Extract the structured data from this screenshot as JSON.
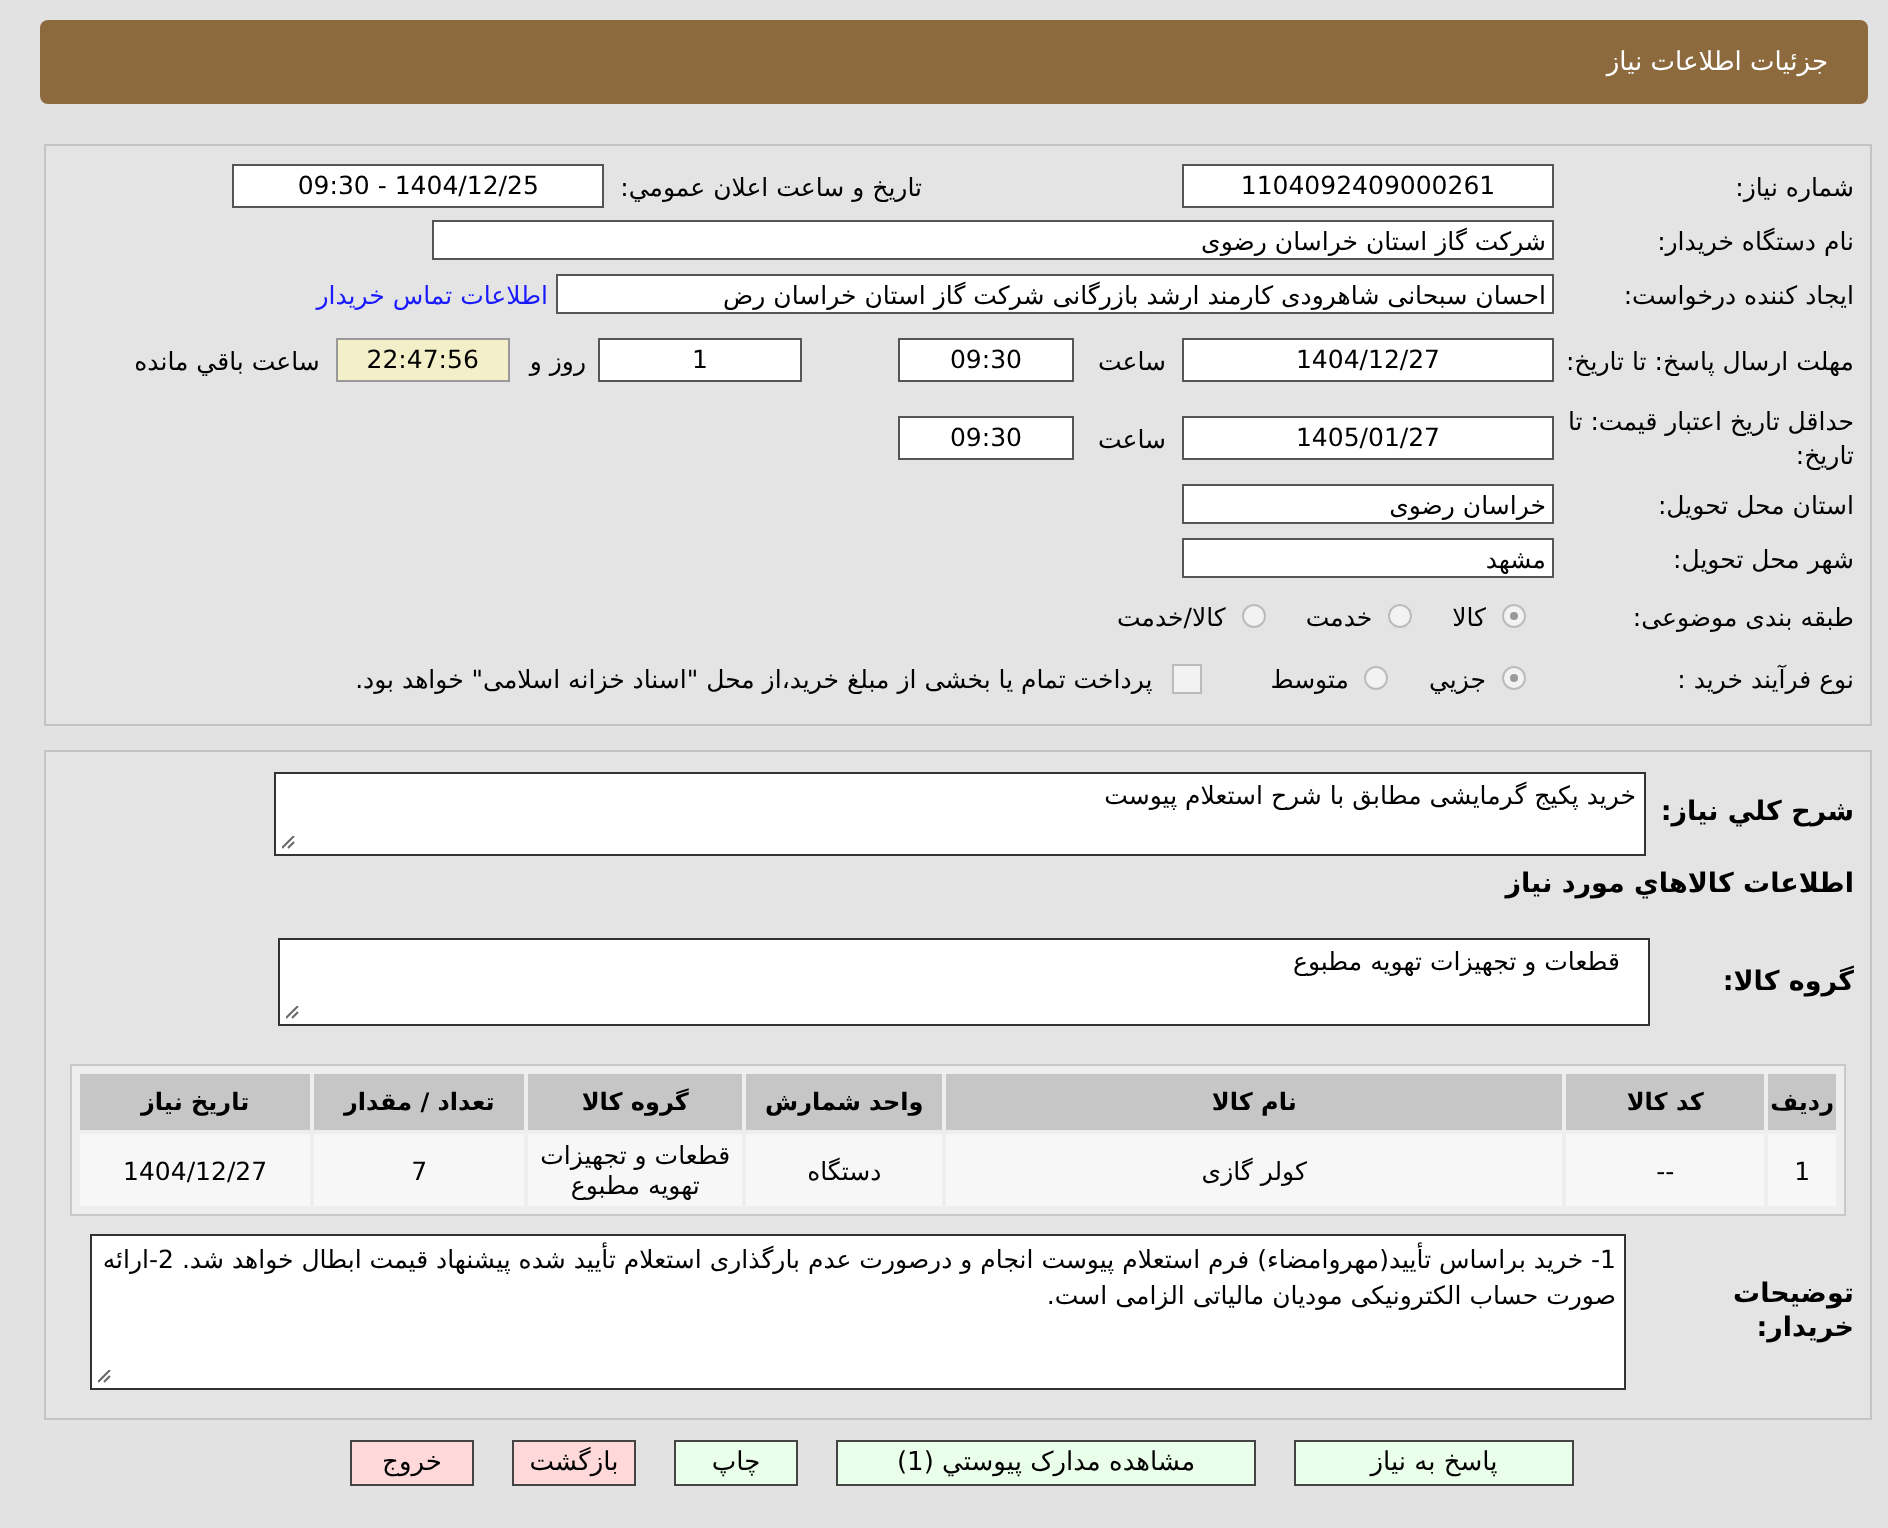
{
  "header": {
    "title": "جزئیات اطلاعات نیاز"
  },
  "need_number": {
    "label": "شماره نیاز:",
    "value": "1104092409000261"
  },
  "announce": {
    "label": "تاریخ و ساعت اعلان عمومي:",
    "value": "1404/12/25 - 09:30"
  },
  "buyer_org": {
    "label": "نام دستگاه خریدار:",
    "value": "شرکت گاز استان خراسان رضوی"
  },
  "requester": {
    "label": "ایجاد کننده درخواست:",
    "value": "احسان سبحانی شاهرودی کارمند ارشد بازرگانی شرکت گاز استان خراسان رض",
    "link": "اطلاعات تماس خریدار"
  },
  "reply_deadline": {
    "label": "مهلت ارسال پاسخ: تا تاریخ:",
    "date": "1404/12/27",
    "time_label": "ساعت",
    "time": "09:30",
    "days": "1",
    "days_label": "روز و",
    "remaining": "22:47:56",
    "remaining_label": "ساعت باقي مانده"
  },
  "price_validity": {
    "label": "حداقل تاریخ اعتبار قیمت: تا تاریخ:",
    "date": "1405/01/27",
    "time_label": "ساعت",
    "time": "09:30"
  },
  "province": {
    "label": "استان محل تحویل:",
    "value": "خراسان رضوی"
  },
  "city": {
    "label": "شهر محل تحویل:",
    "value": "مشهد"
  },
  "category": {
    "label": "طبقه بندی موضوعی:",
    "options": [
      {
        "label": "کالا",
        "selected": true
      },
      {
        "label": "خدمت",
        "selected": false
      },
      {
        "label": "کالا/خدمت",
        "selected": false
      }
    ]
  },
  "process": {
    "label": "نوع فرآیند خرید :",
    "options": [
      {
        "label": "جزيي",
        "selected": true
      },
      {
        "label": "متوسط",
        "selected": false
      }
    ],
    "payment": {
      "checked": false,
      "text": "پرداخت تمام یا بخشی از مبلغ خرید،از محل \"اسناد خزانه اسلامی\" خواهد بود."
    }
  },
  "description": {
    "label": "شرح کلي نياز:",
    "value": "خرید پکیج گرمایشی مطابق با شرح استعلام پیوست"
  },
  "goods_heading": "اطلاعات کالاهاي مورد نياز",
  "goods_group": {
    "label": "گروه کالا:",
    "value": "قطعات و تجهیزات تهویه مطبوع"
  },
  "table": {
    "columns": [
      "ردیف",
      "کد کالا",
      "نام کالا",
      "واحد شمارش",
      "گروه کالا",
      "تعداد / مقدار",
      "تاریخ نیاز"
    ],
    "rows": [
      [
        "1",
        "--",
        "کولر گازی",
        "دستگاه",
        "قطعات و تجهیزات تهویه مطبوع",
        "7",
        "1404/12/27"
      ]
    ]
  },
  "notes": {
    "label": "توضیحات خریدار:",
    "value": "1- خرید براساس تأیید(مهروامضاء) فرم استعلام پیوست انجام و درصورت عدم بارگذاری استعلام تأیید شده پیشنهاد قیمت ابطال خواهد شد. 2-ارائه صورت حساب الکترونیکی مودیان مالیاتی الزامی است."
  },
  "buttons": [
    {
      "label": "پاسخ به نیاز",
      "kind": "action"
    },
    {
      "label": "مشاهده مدارک پیوستي (1)",
      "kind": "action"
    },
    {
      "label": "چاپ",
      "kind": "action"
    },
    {
      "label": "بازگشت",
      "kind": "leave"
    },
    {
      "label": "خروج",
      "kind": "leave"
    }
  ]
}
